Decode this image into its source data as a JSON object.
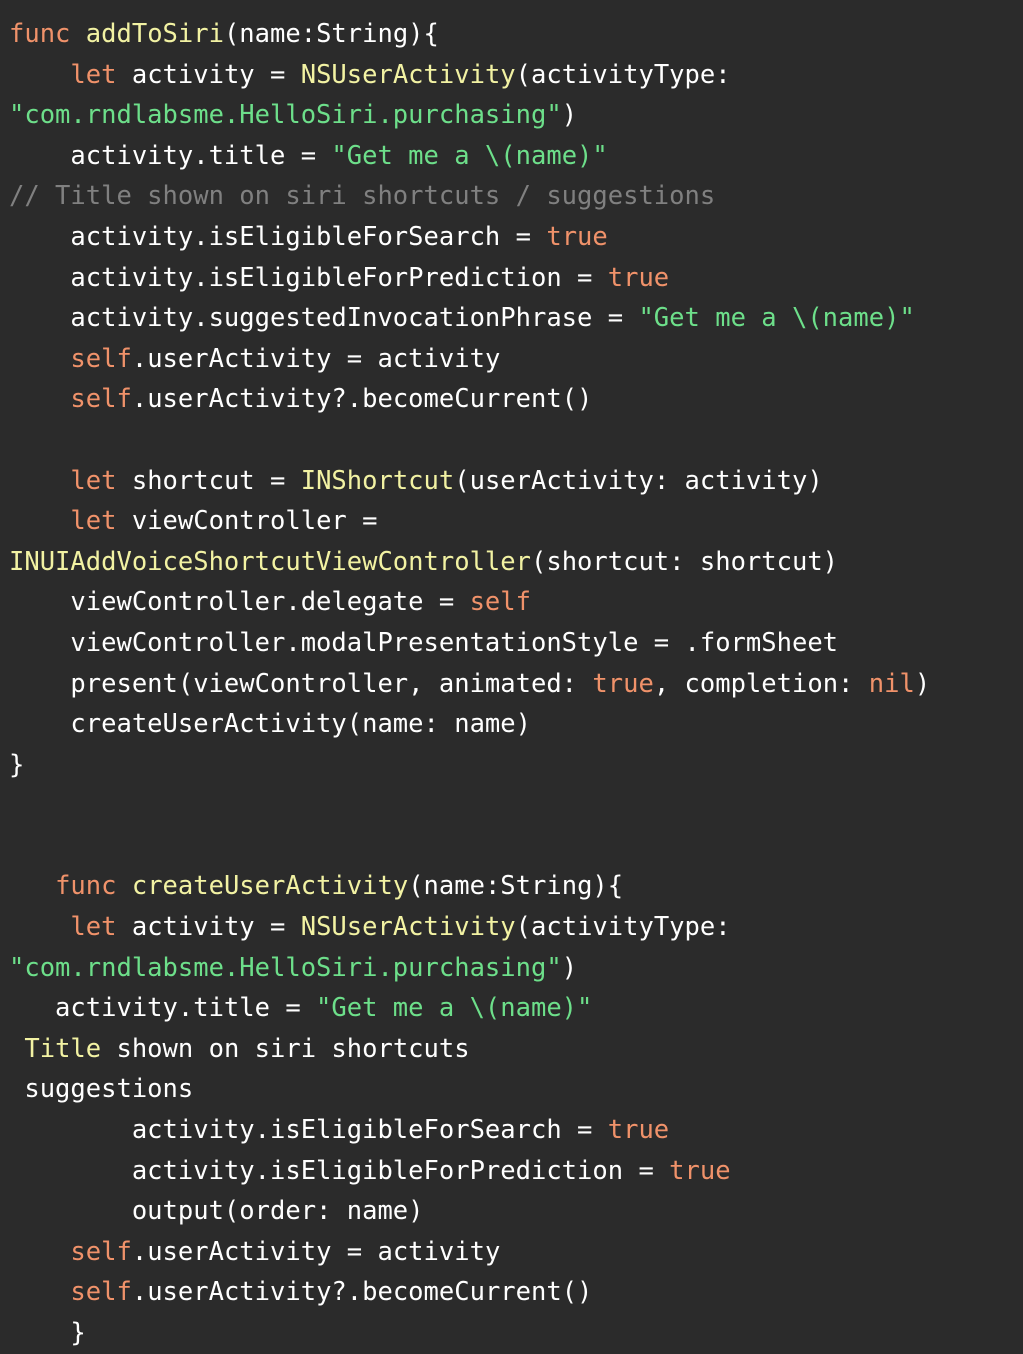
{
  "editor": {
    "language": "Swift",
    "background_color": "#2b2b2b",
    "colors": {
      "plain": "#ffffff",
      "keyword": "#f0926a",
      "type": "#f2f2a3",
      "string": "#6ddf8a",
      "comment": "#808080",
      "literal": "#f0926a"
    }
  },
  "lines": [
    {
      "index": 0,
      "text": "func addToSiri(name:String){",
      "tokens": [
        {
          "t": "func",
          "k": "keyword"
        },
        {
          "t": " ",
          "k": "plain"
        },
        {
          "t": "addToSiri",
          "k": "type"
        },
        {
          "t": "(name:String){",
          "k": "plain"
        }
      ]
    },
    {
      "index": 1,
      "text": "    let activity = NSUserActivity(activityType:",
      "tokens": [
        {
          "t": "    ",
          "k": "plain"
        },
        {
          "t": "let",
          "k": "keyword"
        },
        {
          "t": " activity = ",
          "k": "plain"
        },
        {
          "t": "NSUserActivity",
          "k": "type"
        },
        {
          "t": "(activityType:",
          "k": "plain"
        }
      ]
    },
    {
      "index": 2,
      "text": "\"com.rndlabsme.HelloSiri.purchasing\")",
      "tokens": [
        {
          "t": "\"com.rndlabsme.HelloSiri.purchasing\"",
          "k": "string"
        },
        {
          "t": ")",
          "k": "plain"
        }
      ]
    },
    {
      "index": 3,
      "text": "    activity.title = \"Get me a \\(name)\"",
      "tokens": [
        {
          "t": "    activity.title = ",
          "k": "plain"
        },
        {
          "t": "\"Get me a \\(name)\"",
          "k": "string"
        }
      ]
    },
    {
      "index": 4,
      "text": "// Title shown on siri shortcuts / suggestions",
      "tokens": [
        {
          "t": "// Title shown on siri shortcuts / suggestions",
          "k": "comment"
        }
      ]
    },
    {
      "index": 5,
      "text": "    activity.isEligibleForSearch = true",
      "tokens": [
        {
          "t": "    activity.isEligibleForSearch = ",
          "k": "plain"
        },
        {
          "t": "true",
          "k": "literal"
        }
      ]
    },
    {
      "index": 6,
      "text": "    activity.isEligibleForPrediction = true",
      "tokens": [
        {
          "t": "    activity.isEligibleForPrediction = ",
          "k": "plain"
        },
        {
          "t": "true",
          "k": "literal"
        }
      ]
    },
    {
      "index": 7,
      "text": "    activity.suggestedInvocationPhrase = \"Get me a \\(name)\"",
      "tokens": [
        {
          "t": "    activity.suggestedInvocationPhrase = ",
          "k": "plain"
        },
        {
          "t": "\"Get me a \\(name)\"",
          "k": "string"
        }
      ]
    },
    {
      "index": 8,
      "text": "    self.userActivity = activity",
      "tokens": [
        {
          "t": "    ",
          "k": "plain"
        },
        {
          "t": "self",
          "k": "keyword"
        },
        {
          "t": ".userActivity = activity",
          "k": "plain"
        }
      ]
    },
    {
      "index": 9,
      "text": "    self.userActivity?.becomeCurrent()",
      "tokens": [
        {
          "t": "    ",
          "k": "plain"
        },
        {
          "t": "self",
          "k": "keyword"
        },
        {
          "t": ".userActivity?.becomeCurrent()",
          "k": "plain"
        }
      ]
    },
    {
      "index": 10,
      "text": "",
      "tokens": []
    },
    {
      "index": 11,
      "text": "    let shortcut = INShortcut(userActivity: activity)",
      "tokens": [
        {
          "t": "    ",
          "k": "plain"
        },
        {
          "t": "let",
          "k": "keyword"
        },
        {
          "t": " shortcut = ",
          "k": "plain"
        },
        {
          "t": "INShortcut",
          "k": "type"
        },
        {
          "t": "(userActivity: activity)",
          "k": "plain"
        }
      ]
    },
    {
      "index": 12,
      "text": "    let viewController =",
      "tokens": [
        {
          "t": "    ",
          "k": "plain"
        },
        {
          "t": "let",
          "k": "keyword"
        },
        {
          "t": " viewController =",
          "k": "plain"
        }
      ]
    },
    {
      "index": 13,
      "text": "INUIAddVoiceShortcutViewController(shortcut: shortcut)",
      "tokens": [
        {
          "t": "INUIAddVoiceShortcutViewController",
          "k": "type"
        },
        {
          "t": "(shortcut: shortcut)",
          "k": "plain"
        }
      ]
    },
    {
      "index": 14,
      "text": "    viewController.delegate = self",
      "tokens": [
        {
          "t": "    viewController.delegate = ",
          "k": "plain"
        },
        {
          "t": "self",
          "k": "keyword"
        }
      ]
    },
    {
      "index": 15,
      "text": "    viewController.modalPresentationStyle = .formSheet",
      "tokens": [
        {
          "t": "    viewController.modalPresentationStyle = .formSheet",
          "k": "plain"
        }
      ]
    },
    {
      "index": 16,
      "text": "    present(viewController, animated: true, completion: nil)",
      "tokens": [
        {
          "t": "    present(viewController, animated: ",
          "k": "plain"
        },
        {
          "t": "true",
          "k": "literal"
        },
        {
          "t": ", completion: ",
          "k": "plain"
        },
        {
          "t": "nil",
          "k": "literal"
        },
        {
          "t": ")",
          "k": "plain"
        }
      ]
    },
    {
      "index": 17,
      "text": "    createUserActivity(name: name)",
      "tokens": [
        {
          "t": "    createUserActivity(name: name)",
          "k": "plain"
        }
      ]
    },
    {
      "index": 18,
      "text": "}",
      "tokens": [
        {
          "t": "}",
          "k": "plain"
        }
      ]
    },
    {
      "index": 19,
      "text": "",
      "tokens": []
    },
    {
      "index": 20,
      "text": "",
      "tokens": []
    },
    {
      "index": 21,
      "text": "   func createUserActivity(name:String){",
      "tokens": [
        {
          "t": "   ",
          "k": "plain"
        },
        {
          "t": "func",
          "k": "keyword"
        },
        {
          "t": " ",
          "k": "plain"
        },
        {
          "t": "createUserActivity",
          "k": "type"
        },
        {
          "t": "(name:String){",
          "k": "plain"
        }
      ]
    },
    {
      "index": 22,
      "text": "    let activity = NSUserActivity(activityType:",
      "tokens": [
        {
          "t": "    ",
          "k": "plain"
        },
        {
          "t": "let",
          "k": "keyword"
        },
        {
          "t": " activity = ",
          "k": "plain"
        },
        {
          "t": "NSUserActivity",
          "k": "type"
        },
        {
          "t": "(activityType:",
          "k": "plain"
        }
      ]
    },
    {
      "index": 23,
      "text": "\"com.rndlabsme.HelloSiri.purchasing\")",
      "tokens": [
        {
          "t": "\"com.rndlabsme.HelloSiri.purchasing\"",
          "k": "string"
        },
        {
          "t": ")",
          "k": "plain"
        }
      ]
    },
    {
      "index": 24,
      "text": "   activity.title = \"Get me a \\(name)\"",
      "tokens": [
        {
          "t": "   activity.title = ",
          "k": "plain"
        },
        {
          "t": "\"Get me a \\(name)\"",
          "k": "string"
        }
      ]
    },
    {
      "index": 25,
      "text": " Title shown on siri shortcuts",
      "tokens": [
        {
          "t": " ",
          "k": "plain"
        },
        {
          "t": "Title",
          "k": "type"
        },
        {
          "t": " shown on siri shortcuts",
          "k": "plain"
        }
      ]
    },
    {
      "index": 26,
      "text": " suggestions",
      "tokens": [
        {
          "t": " suggestions",
          "k": "plain"
        }
      ]
    },
    {
      "index": 27,
      "text": "        activity.isEligibleForSearch = true",
      "tokens": [
        {
          "t": "        activity.isEligibleForSearch = ",
          "k": "plain"
        },
        {
          "t": "true",
          "k": "literal"
        }
      ]
    },
    {
      "index": 28,
      "text": "        activity.isEligibleForPrediction = true",
      "tokens": [
        {
          "t": "        activity.isEligibleForPrediction = ",
          "k": "plain"
        },
        {
          "t": "true",
          "k": "literal"
        }
      ]
    },
    {
      "index": 29,
      "text": "        output(order: name)",
      "tokens": [
        {
          "t": "        output(order: name)",
          "k": "plain"
        }
      ]
    },
    {
      "index": 30,
      "text": "    self.userActivity = activity",
      "tokens": [
        {
          "t": "    ",
          "k": "plain"
        },
        {
          "t": "self",
          "k": "keyword"
        },
        {
          "t": ".userActivity = activity",
          "k": "plain"
        }
      ]
    },
    {
      "index": 31,
      "text": "    self.userActivity?.becomeCurrent()",
      "tokens": [
        {
          "t": "    ",
          "k": "plain"
        },
        {
          "t": "self",
          "k": "keyword"
        },
        {
          "t": ".userActivity?.becomeCurrent()",
          "k": "plain"
        }
      ]
    },
    {
      "index": 32,
      "text": "    }",
      "tokens": [
        {
          "t": "    }",
          "k": "plain"
        }
      ]
    }
  ]
}
